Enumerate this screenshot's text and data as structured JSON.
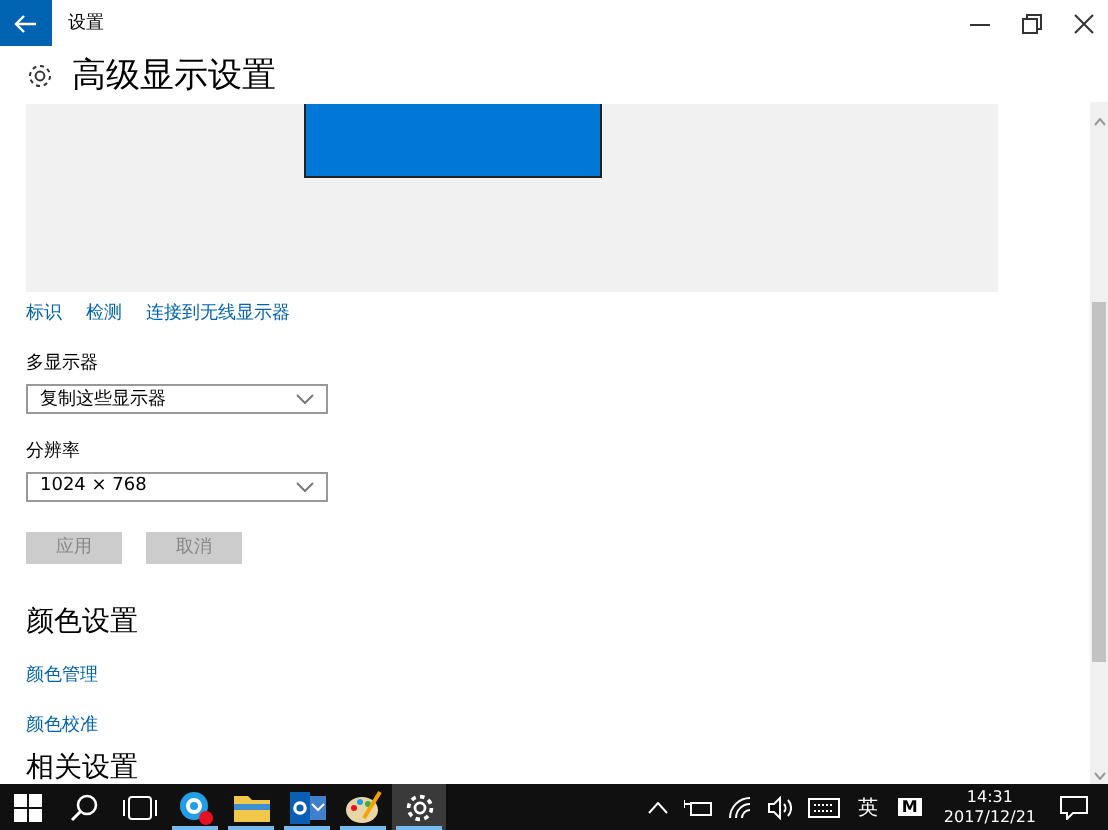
{
  "window": {
    "title": "设置"
  },
  "page_title": "高级显示设置",
  "display_links": [
    {
      "label": "标识"
    },
    {
      "label": "检测"
    },
    {
      "label": "连接到无线显示器"
    }
  ],
  "multiple_displays": {
    "label": "多显示器",
    "value": "复制这些显示器"
  },
  "resolution": {
    "label": "分辨率",
    "value": "1024 × 768"
  },
  "buttons": [
    {
      "label": "应用",
      "disabled": true
    },
    {
      "label": "取消",
      "disabled": true
    }
  ],
  "color_section": {
    "heading": "颜色设置",
    "links": [
      {
        "label": "颜色管理"
      },
      {
        "label": "颜色校准"
      }
    ]
  },
  "related_section": {
    "heading": "相关设置"
  },
  "taskbar": {
    "apps": [
      {
        "kind": "start",
        "selected": false
      },
      {
        "kind": "search",
        "selected": false
      },
      {
        "kind": "taskview",
        "selected": false
      },
      {
        "kind": "skype",
        "selected": false
      },
      {
        "kind": "explorer",
        "selected": false
      },
      {
        "kind": "outlook",
        "selected": false
      },
      {
        "kind": "paint",
        "selected": false
      },
      {
        "kind": "settings",
        "selected": true
      }
    ],
    "tray": {
      "input_language": "英",
      "ime": "M",
      "time": "14:31",
      "date": "2017/12/21"
    }
  }
}
